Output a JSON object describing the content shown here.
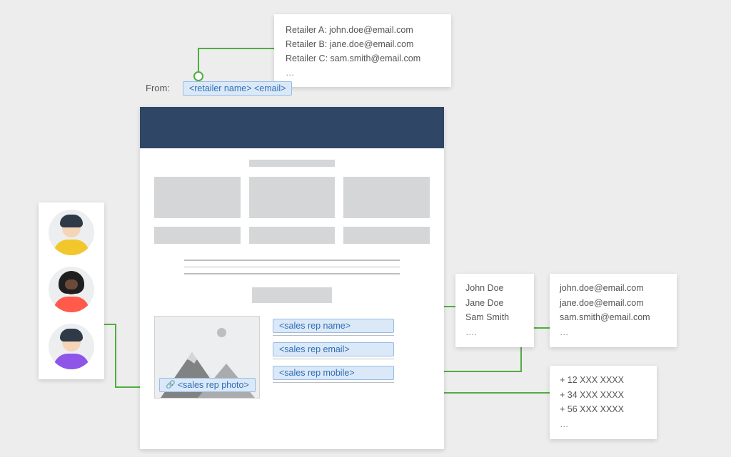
{
  "from": {
    "label": "From:",
    "token": "<retailer name> <email>"
  },
  "retailer_list": {
    "lines": [
      "Retailer A: john.doe@email.com",
      "Retailer B: jane.doe@email.com",
      "Retailer C: sam.smith@email.com"
    ],
    "ellipsis": "…"
  },
  "footer_tokens": {
    "photo": "<sales rep photo>",
    "name": "<sales rep name>",
    "email": "<sales rep email>",
    "mobile": "<sales rep mobile>"
  },
  "names_list": {
    "lines": [
      "John Doe",
      "Jane Doe",
      "Sam Smith"
    ],
    "ellipsis": "…."
  },
  "emails_list": {
    "lines": [
      "john.doe@email.com",
      "jane.doe@email.com",
      "sam.smith@email.com"
    ],
    "ellipsis": "…"
  },
  "phones_list": {
    "lines": [
      "+ 12 XXX XXXX",
      "+ 34 XXX XXXX",
      "+ 56 XXX XXXX"
    ],
    "ellipsis": "…"
  },
  "avatars": [
    {
      "skin": "#f5d5b8",
      "hair": "#2e3a47",
      "shirt": "#f2c72b"
    },
    {
      "skin": "#6b4a3a",
      "hair": "#1f1f1f",
      "shirt": "#ff5a4a"
    },
    {
      "skin": "#f5d5b8",
      "hair": "#2e3a47",
      "shirt": "#8e55e8"
    }
  ],
  "colors": {
    "token_bg": "#dbe8f8",
    "token_border": "#96bce6",
    "token_text": "#2f6fb3",
    "connector": "#4fae40",
    "navy": "#2f4666",
    "grey": "#d4d6d8"
  }
}
